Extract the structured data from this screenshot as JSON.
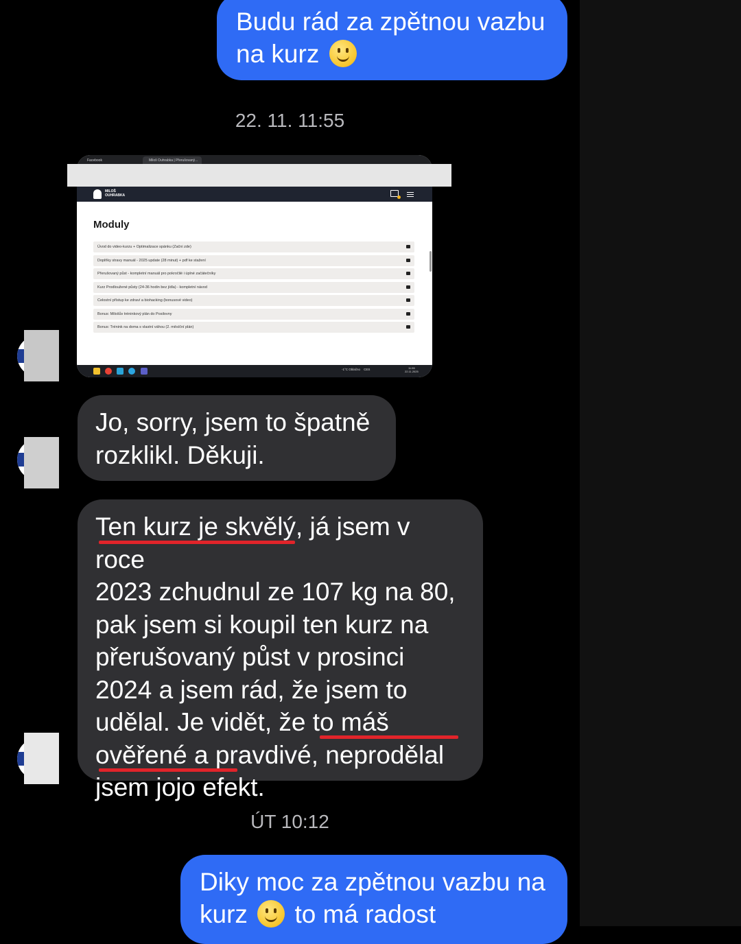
{
  "messages": {
    "out_1": {
      "line1": "Budu rád za zpětnou vazbu",
      "line2_prefix": "na kurz"
    },
    "timestamp_1": "22. 11. 11:55",
    "attachment": {
      "browser_tabs": [
        "Facebook",
        "Miloš Ouhrabka | Přerušovaný..."
      ],
      "site_logo_line1": "MILOŠ",
      "site_logo_line2": "OUHRABKA",
      "section_title": "Moduly",
      "modules": [
        "Úvod do video-kurzu + Optimalizace spánku (Začni zde)",
        "Doplňky stravy manuál - 2025 update (28 minut) + pdf ke stažení",
        "Přerušovaný půst - kompletní manuál pro pokročilé i úplné začátečníky",
        "Kurz Prodloužené půsty (24-36 hodin bez jídla) - kompletní návod",
        "Celostní přístup ke zdraví a biohacking (bonusové video)",
        "Bonus: Milošův tréninkový plán do Posilovny",
        "Bonus: Trénink na doma s vlastní váhou (2. měsíční plán)"
      ],
      "tray_weather": "-1°C  Oblačno",
      "tray_lang": "CES",
      "tray_time": "11:55",
      "tray_date": "22.11.2025"
    },
    "in_1": {
      "line1": "Jo, sorry, jsem to špatně",
      "line2": "rozklikl. Děkuji."
    },
    "in_2": {
      "lines": [
        "Ten kurz je skvělý, já jsem v roce",
        "2023 zchudnul ze 107 kg na 80,",
        "pak jsem si koupil ten kurz na",
        "přerušovaný půst v prosinci",
        "2024 a jsem rád, že jsem to",
        "udělal. Je vidět, že to máš",
        "ověřené a pravdivé, neprodělal",
        "jsem jojo efekt."
      ]
    },
    "timestamp_2": "ÚT 10:12",
    "out_2": {
      "line1": "Diky moc za zpětnou vazbu na",
      "line2_prefix": "kurz",
      "line2_suffix": "to má radost"
    }
  },
  "colors": {
    "outgoing_bubble": "#2f6bf5",
    "incoming_bubble": "#303033",
    "highlight_underline": "#e1242a",
    "background": "#000000"
  },
  "icons": [
    "smile-emoji",
    "cart-icon",
    "menu-icon",
    "lock-icon",
    "avatar"
  ]
}
